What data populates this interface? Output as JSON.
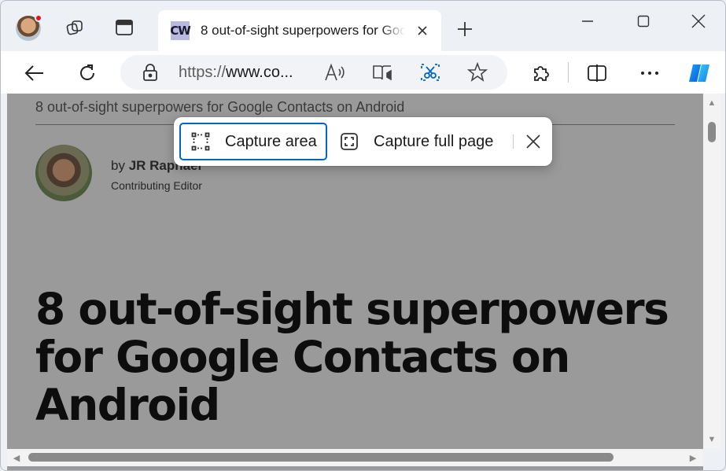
{
  "browser": {
    "tab": {
      "favicon_text": "CW",
      "title": "8 out-of-sight superpowers for Google Contacts on Android"
    },
    "toolbar": {
      "url_prefix": "https://",
      "url_host": "www.co...",
      "read_aloud_icon": "read-aloud-icon",
      "immersive_reader_icon": "immersive-reader-icon",
      "screenshot_icon": "screenshot-icon",
      "favorite_icon": "star-icon",
      "extensions_icon": "puzzle-icon",
      "split_screen_icon": "split-screen-icon",
      "more_icon": "more-icon",
      "copilot_icon": "copilot-icon"
    },
    "accent_color": "#0067c0"
  },
  "capture": {
    "area_label": "Capture area",
    "full_page_label": "Capture full page"
  },
  "article": {
    "top_title": "8 out-of-sight superpowers for Google Contacts on Android",
    "by": "by ",
    "author": "JR Raphael",
    "role": "Contributing Editor",
    "headline": "8 out-of-sight superpowers for Google Contacts on Android"
  }
}
